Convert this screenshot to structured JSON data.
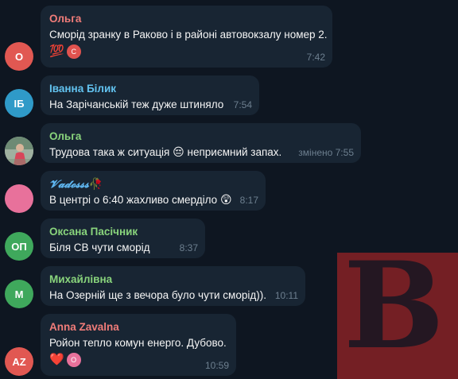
{
  "messages": [
    {
      "avatar_initials": "О",
      "avatar_color": "#e15852",
      "name": "Ольга",
      "name_color": "#f07c79",
      "text": "Сморід зранку в Раково і в районі автовокзалу номер 2.",
      "time": "7:42",
      "reaction": {
        "emoji": "💯",
        "user_initial": "С",
        "user_color": "#e0534f"
      }
    },
    {
      "avatar_initials": "ІБ",
      "avatar_color": "#2f9ac8",
      "name": "Іванна Білик",
      "name_color": "#62c3f0",
      "text": "На Зарічанській теж дуже штиняло",
      "time": "7:54"
    },
    {
      "avatar_type": "photo",
      "name": "Ольга",
      "name_color": "#89d47c",
      "text": "Трудова така ж ситуація",
      "text_emoji": "😔",
      "text_after": " неприємний запах.",
      "time": "змінено 7:55"
    },
    {
      "avatar_initials": "",
      "avatar_color": "#e8719b",
      "name": "𝓥𝓪𝓭𝓸𝓼𝓼𝓼",
      "name_color": "#5fb6f0",
      "name_emoji": "🥀",
      "text": "В центрі о 6:40 жахливо смерділо",
      "text_emoji": "😲",
      "time": "8:17"
    },
    {
      "avatar_initials": "ОП",
      "avatar_color": "#3fa85c",
      "name": "Оксана Пасічник",
      "name_color": "#89d47c",
      "text": "Біля СВ чути сморід",
      "time": "8:37"
    },
    {
      "avatar_initials": "М",
      "avatar_color": "#3fa85c",
      "name": "Михайлівна",
      "name_color": "#89d47c",
      "text": "На Озерній ще з вечора було чути сморід)).",
      "time": "10:11"
    },
    {
      "avatar_initials": "AZ",
      "avatar_color": "#e15852",
      "name": "Anna Zavalna",
      "name_color": "#f07c79",
      "text": "Ройон тепло комун енерго. Дубово.",
      "time": "10:59",
      "reaction": {
        "emoji": "❤️",
        "user_initial": "О",
        "user_color": "#e8719b"
      }
    }
  ],
  "watermark": {
    "letter": "B"
  }
}
